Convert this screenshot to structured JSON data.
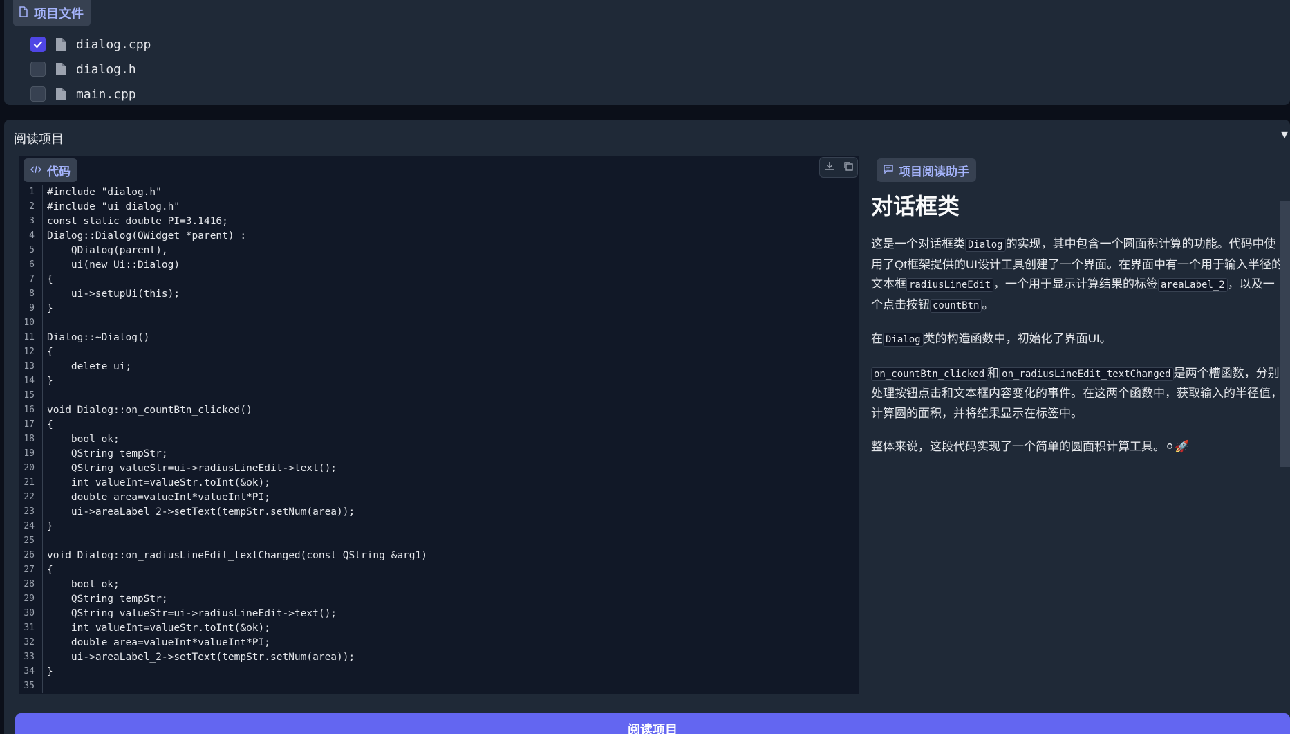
{
  "files_panel": {
    "tag_label": "项目文件",
    "files": [
      {
        "name": "dialog.cpp",
        "checked": true
      },
      {
        "name": "dialog.h",
        "checked": false
      },
      {
        "name": "main.cpp",
        "checked": false
      }
    ]
  },
  "main": {
    "section_label": "阅读项目",
    "collapse_glyph": "▼",
    "code_tag": "代码",
    "code_lines": [
      "#include \"dialog.h\"",
      "#include \"ui_dialog.h\"",
      "const static double PI=3.1416;",
      "Dialog::Dialog(QWidget *parent) :",
      "    QDialog(parent),",
      "    ui(new Ui::Dialog)",
      "{",
      "    ui->setupUi(this);",
      "}",
      "",
      "Dialog::~Dialog()",
      "{",
      "    delete ui;",
      "}",
      "",
      "void Dialog::on_countBtn_clicked()",
      "{",
      "    bool ok;",
      "    QString tempStr;",
      "    QString valueStr=ui->radiusLineEdit->text();",
      "    int valueInt=valueStr.toInt(&ok);",
      "    double area=valueInt*valueInt*PI;",
      "    ui->areaLabel_2->setText(tempStr.setNum(area));",
      "}",
      "",
      "void Dialog::on_radiusLineEdit_textChanged(const QString &arg1)",
      "{",
      "    bool ok;",
      "    QString tempStr;",
      "    QString valueStr=ui->radiusLineEdit->text();",
      "    int valueInt=valueStr.toInt(&ok);",
      "    double area=valueInt*valueInt*PI;",
      "    ui->areaLabel_2->setText(tempStr.setNum(area));",
      "}",
      ""
    ],
    "assistant": {
      "tag_label": "项目阅读助手",
      "heading": "对话框类",
      "p1": {
        "t1": "这是一个对话框类",
        "c1": "Dialog",
        "t2": "的实现，其中包含一个圆面积计算的功能。代码中使用了Qt框架提供的UI设计工具创建了一个界面。在界面中有一个用于输入半径的文本框",
        "c2": "radiusLineEdit",
        "t3": "，一个用于显示计算结果的标签",
        "c3": "areaLabel_2",
        "t4": "，以及一个点击按钮",
        "c4": "countBtn",
        "t5": "。"
      },
      "p2": {
        "t1": "在",
        "c1": "Dialog",
        "t2": "类的构造函数中，初始化了界面UI。"
      },
      "p3": {
        "c1": "on_countBtn_clicked",
        "t1": "和",
        "c2": "on_radiusLineEdit_textChanged",
        "t2": "是两个槽函数，分别处理按钮点击和文本框内容变化的事件。在这两个函数中，获取输入的半径值，计算圆的面积，并将结果显示在标签中。"
      },
      "p4": {
        "t1": "整体来说，这段代码实现了一个简单的圆面积计算工具。",
        "emoji": "⚪🚀"
      }
    }
  },
  "bottom_button_label": "阅读项目",
  "colors": {
    "accent": "#6366f1",
    "checkbox_checked": "#4f46e5",
    "panel_bg": "#1f2937",
    "page_bg": "#0b0f19"
  }
}
